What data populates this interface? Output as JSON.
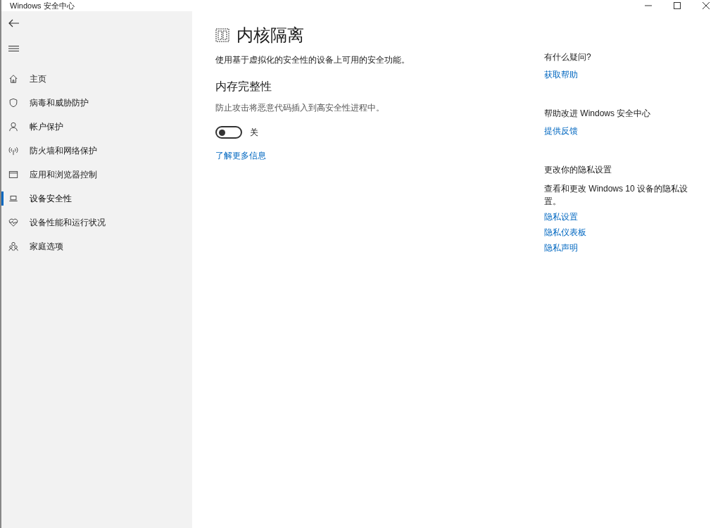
{
  "window": {
    "title": "Windows 安全中心"
  },
  "sidebar": {
    "items": [
      {
        "kind": "home",
        "label": "主页",
        "selected": false
      },
      {
        "kind": "shield",
        "label": "病毒和威胁防护",
        "selected": false
      },
      {
        "kind": "person",
        "label": "帐户保护",
        "selected": false
      },
      {
        "kind": "antenna",
        "label": "防火墙和网络保护",
        "selected": false
      },
      {
        "kind": "window",
        "label": "应用和浏览器控制",
        "selected": false
      },
      {
        "kind": "laptop",
        "label": "设备安全性",
        "selected": true
      },
      {
        "kind": "heart",
        "label": "设备性能和运行状况",
        "selected": false
      },
      {
        "kind": "family",
        "label": "家庭选项",
        "selected": false
      }
    ]
  },
  "page": {
    "title": "内核隔离",
    "description": "使用基于虚拟化的安全性的设备上可用的安全功能。",
    "section": {
      "title": "内存完整性",
      "description": "防止攻击将恶意代码插入到高安全性进程中。",
      "toggle": {
        "on": false,
        "label": "关"
      },
      "link": "了解更多信息"
    }
  },
  "aside": [
    {
      "title": "有什么疑问?",
      "links": [
        "获取帮助"
      ]
    },
    {
      "title": "帮助改进 Windows 安全中心",
      "links": [
        "提供反馈"
      ]
    },
    {
      "title": "更改你的隐私设置",
      "text": "查看和更改 Windows 10 设备的隐私设置。",
      "links": [
        "隐私设置",
        "隐私仪表板",
        "隐私声明"
      ]
    }
  ]
}
